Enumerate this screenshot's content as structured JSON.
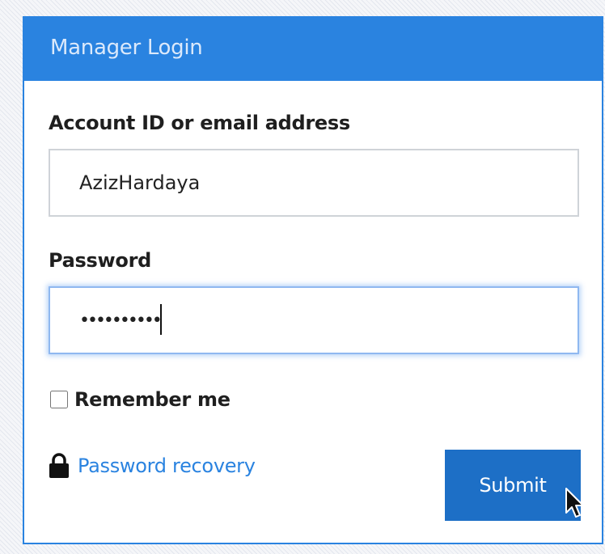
{
  "panel": {
    "title": "Manager Login"
  },
  "account": {
    "label": "Account ID or email address",
    "value": "AzizHardaya"
  },
  "password": {
    "label": "Password",
    "masked_value": "••••••••••"
  },
  "remember": {
    "label": "Remember me",
    "checked": false
  },
  "recovery": {
    "label": "Password recovery",
    "icon": "lock-icon"
  },
  "submit": {
    "label": "Submit"
  },
  "colors": {
    "accent": "#2a83e0",
    "button": "#1d6fc6",
    "text": "#1f1f1f"
  }
}
